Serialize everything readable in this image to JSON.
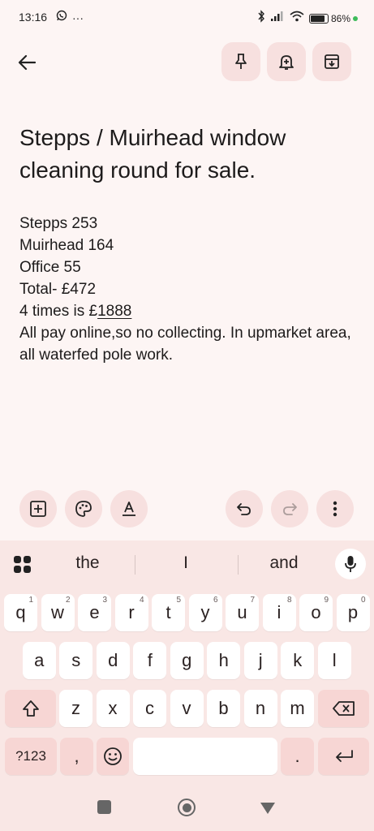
{
  "status_bar": {
    "time": "13:16",
    "overflow": "···",
    "battery": "86%",
    "icons": [
      "whatsapp-icon",
      "bluetooth-icon",
      "signal-icon",
      "wifi-icon",
      "battery-icon"
    ]
  },
  "topbar": {
    "icons": [
      "back-arrow-icon",
      "pin-icon",
      "reminder-bell-icon",
      "archive-icon"
    ]
  },
  "note": {
    "title": "Stepps / Muirhead window cleaning round for sale.",
    "lines": [
      "Stepps 253",
      "Muirhead 164",
      "Office 55",
      "Total- £472",
      "4 times is £",
      "1888",
      "All pay online,so no collecting. In upmarket area, all waterfed pole work."
    ]
  },
  "editor_toolbar": {
    "icons": [
      "add-box-icon",
      "palette-icon",
      "text-format-icon",
      "undo-icon",
      "redo-icon",
      "more-vert-icon"
    ]
  },
  "keyboard": {
    "suggestions": [
      "the",
      "I",
      "and"
    ],
    "row1": [
      {
        "k": "q",
        "h": "1"
      },
      {
        "k": "w",
        "h": "2"
      },
      {
        "k": "e",
        "h": "3"
      },
      {
        "k": "r",
        "h": "4"
      },
      {
        "k": "t",
        "h": "5"
      },
      {
        "k": "y",
        "h": "6"
      },
      {
        "k": "u",
        "h": "7"
      },
      {
        "k": "i",
        "h": "8"
      },
      {
        "k": "o",
        "h": "9"
      },
      {
        "k": "p",
        "h": "0"
      }
    ],
    "row2": [
      "a",
      "s",
      "d",
      "f",
      "g",
      "h",
      "j",
      "k",
      "l"
    ],
    "row3": [
      "z",
      "x",
      "c",
      "v",
      "b",
      "n",
      "m"
    ],
    "symbols_key": "?123",
    "comma_key": ",",
    "period_key": "."
  },
  "colors": {
    "background": "#fdf5f4",
    "button_tint": "#f7e0df",
    "keyboard_bg": "#f9e7e5",
    "modifier_key": "#f7d6d4",
    "battery_dot": "#3dbb5a"
  }
}
